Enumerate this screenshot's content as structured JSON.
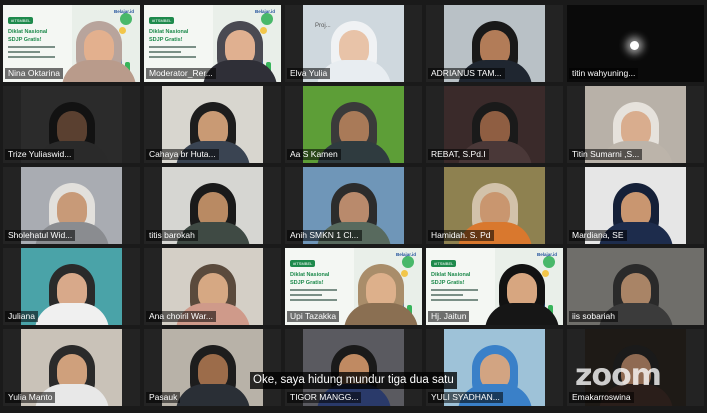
{
  "participants": [
    {
      "name": "Nina Oktarina",
      "active": false,
      "shares_slide": true,
      "camera": "full"
    },
    {
      "name": "Moderator_Rer...",
      "active": true,
      "shares_slide": true,
      "camera": "full"
    },
    {
      "name": "Elva Yulia",
      "active": false,
      "shares_slide": false,
      "camera": "pillar"
    },
    {
      "name": "ADRIANUS TAM...",
      "active": false,
      "shares_slide": false,
      "camera": "pillar"
    },
    {
      "name": "titin wahyuning...",
      "active": false,
      "shares_slide": false,
      "camera": "dark"
    },
    {
      "name": "Trize Yuliaswid...",
      "active": false,
      "shares_slide": false,
      "camera": "pillar"
    },
    {
      "name": "Cahaya br Huta...",
      "active": false,
      "shares_slide": false,
      "camera": "pillar"
    },
    {
      "name": "Aa S Kamen",
      "active": false,
      "shares_slide": false,
      "camera": "pillar"
    },
    {
      "name": "REBAT, S.Pd.I",
      "active": false,
      "shares_slide": false,
      "camera": "pillar"
    },
    {
      "name": "Titin Sumarni ,S...",
      "active": false,
      "shares_slide": false,
      "camera": "pillar"
    },
    {
      "name": "Sholehatul Wid...",
      "active": false,
      "shares_slide": false,
      "camera": "pillar"
    },
    {
      "name": "titis barokah",
      "active": false,
      "shares_slide": false,
      "camera": "pillar"
    },
    {
      "name": "Anih SMKN 1 Cl...",
      "active": false,
      "shares_slide": false,
      "camera": "pillar"
    },
    {
      "name": "Hamidah. S. Pd",
      "active": false,
      "shares_slide": false,
      "camera": "pillar"
    },
    {
      "name": "Mardiana, SE",
      "active": false,
      "shares_slide": false,
      "camera": "pillar"
    },
    {
      "name": "Juliana",
      "active": false,
      "shares_slide": false,
      "camera": "pillar"
    },
    {
      "name": "Ana choiril War...",
      "active": false,
      "shares_slide": false,
      "camera": "pillar"
    },
    {
      "name": "Upi Tazakka",
      "active": false,
      "shares_slide": true,
      "camera": "full"
    },
    {
      "name": "Hj. Jaitun",
      "active": false,
      "shares_slide": true,
      "camera": "full"
    },
    {
      "name": "iis sobariah",
      "active": false,
      "shares_slide": false,
      "camera": "full"
    },
    {
      "name": "Yulia Manto",
      "active": false,
      "shares_slide": false,
      "camera": "pillar"
    },
    {
      "name": "Pasauk",
      "active": false,
      "shares_slide": false,
      "camera": "pillar"
    },
    {
      "name": "TIGOR MANGG...",
      "active": false,
      "shares_slide": false,
      "camera": "pillar"
    },
    {
      "name": "YULI SYADHAN...",
      "active": false,
      "shares_slide": false,
      "camera": "pillar"
    },
    {
      "name": "Emakarroswina",
      "active": false,
      "shares_slide": false,
      "camera": "pillar"
    }
  ],
  "slide": {
    "tag": "#ITSMBEL",
    "title_line1": "Diklat Nasional",
    "title_line2": "SDJP Gratis!",
    "brand": "Belajar.id"
  },
  "caption": "Oke, saya hidung mundur tiga dua satu",
  "watermark": "zoom",
  "overlay_text": "Proj...",
  "colors": {
    "background": "#1a1a1a",
    "active_speaker": "#59d12b",
    "slide_green": "#1e8a4c"
  }
}
